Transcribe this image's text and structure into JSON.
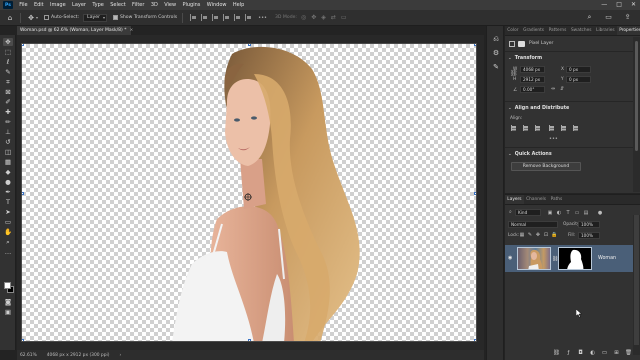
{
  "app": {
    "logo": "Ps"
  },
  "menu": [
    "File",
    "Edit",
    "Image",
    "Layer",
    "Type",
    "Select",
    "Filter",
    "3D",
    "View",
    "Plugins",
    "Window",
    "Help"
  ],
  "window_controls": {
    "minimize": "—",
    "maximize": "□",
    "close": "✕"
  },
  "options_bar": {
    "auto_select_label": "Auto-Select:",
    "auto_select_value": "Layer",
    "show_transform_label": "Show Transform Controls",
    "mode_3d_label": "3D Mode:"
  },
  "document": {
    "tab_title": "Woman.psd @ 62.6% (Woman, Layer Mask/8) *",
    "tab_close": "×"
  },
  "status_bar": {
    "zoom": "62.61%",
    "doc_size": "4068 px x 2912 px (300 ppi)",
    "arrow": "›"
  },
  "panel_top": {
    "tabs": [
      "Color",
      "Gradients",
      "Patterns",
      "Swatches",
      "Libraries",
      "Properties"
    ],
    "active_tab": "Properties",
    "layer_type": "Pixel Layer",
    "transform": {
      "title": "Transform",
      "w_label": "W",
      "w_value": "4068 px",
      "h_label": "H",
      "h_value": "2912 px",
      "x_label": "X",
      "x_value": "0 px",
      "y_label": "Y",
      "y_value": "0 px",
      "angle_value": "0.00°"
    },
    "align": {
      "title": "Align and Distribute",
      "label": "Align:",
      "more": "•••"
    },
    "quick_actions": {
      "title": "Quick Actions",
      "remove_bg": "Remove Background"
    }
  },
  "panel_bottom": {
    "tabs": [
      "Layers",
      "Channels",
      "Paths"
    ],
    "active_tab": "Layers",
    "kind_label": "Kind",
    "blend_mode": "Normal",
    "opacity_label": "Opacity:",
    "opacity_value": "100%",
    "lock_label": "Lock:",
    "fill_label": "Fill:",
    "fill_value": "100%",
    "layer": {
      "name": "Woman",
      "visible": true
    }
  },
  "colors": {
    "accent": "#31a8ff",
    "selected_layer": "#4a5f78",
    "handle_border": "#3a73c4"
  }
}
